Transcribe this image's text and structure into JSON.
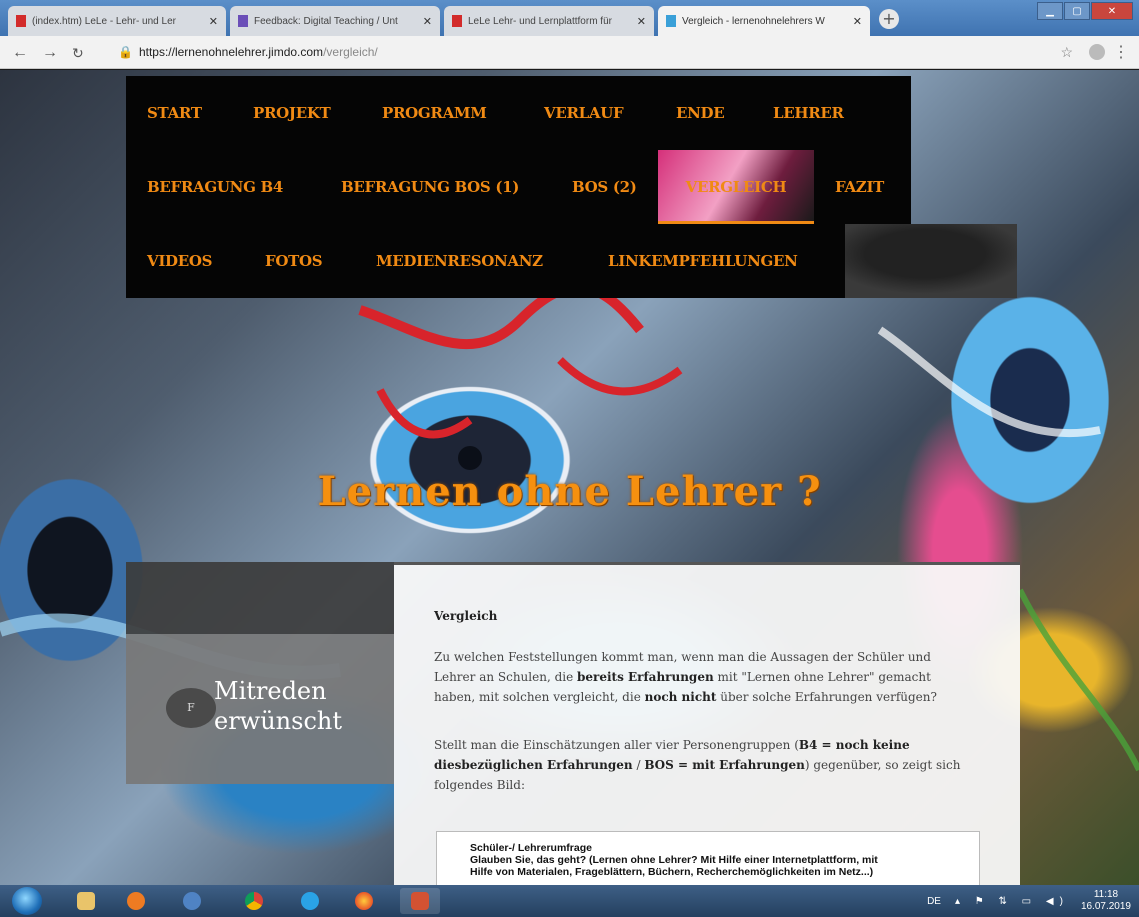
{
  "browser": {
    "tabs": [
      {
        "title": "(index.htm) LeLe - Lehr- und Ler",
        "favicon_color": "#d22b2b",
        "active": false
      },
      {
        "title": "Feedback: Digital Teaching / Unt",
        "favicon_color": "#6b4fb8",
        "active": false
      },
      {
        "title": "LeLe Lehr- und Lernplattform für",
        "favicon_color": "#d22b2b",
        "active": false
      },
      {
        "title": "Vergleich - lernenohnelehrers W",
        "favicon_color": "#3aa0d8",
        "active": true
      }
    ],
    "new_tab_icon": "+",
    "url_host": "https://lernenohnelehrer.jimdo.com",
    "url_path": "/vergleich/"
  },
  "site": {
    "nav": [
      {
        "label": "START"
      },
      {
        "label": "PROJEKT"
      },
      {
        "label": "PROGRAMM"
      },
      {
        "label": "VERLAUF"
      },
      {
        "label": "ENDE"
      },
      {
        "label": "LEHRER"
      },
      {
        "label": "BEFRAGUNG B4"
      },
      {
        "label": "BEFRAGUNG BOS (1)"
      },
      {
        "label": "BOS (2)"
      },
      {
        "label": "VERGLEICH",
        "active": true
      },
      {
        "label": "FAZIT"
      },
      {
        "label": "VIDEOS"
      },
      {
        "label": "FOTOS"
      },
      {
        "label": "MEDIENRESONANZ"
      },
      {
        "label": "LINKEMPFEHLUNGEN"
      }
    ],
    "hero_title": "Lernen ohne Lehrer ?",
    "sidebar": {
      "badge": "F",
      "label_line1": "Mitreden",
      "label_line2": "erwünscht"
    },
    "content": {
      "heading": "Vergleich",
      "p1": {
        "t1": "Zu welchen Feststellungen kommt man, wenn man die Aussagen der Schüler und Lehrer an Schulen, die ",
        "b1": "bereits Erfahrungen",
        "t2": " mit \"Lernen ohne Lehrer\" gemacht haben, mit solchen vergleicht, die ",
        "b2": "noch nicht",
        "t3": " über solche Erfahrungen verfügen?"
      },
      "p2": {
        "t1": "Stellt man die Einschätzungen aller vier Personengruppen (",
        "b1": "B4 = noch keine diesbezüglichen Erfahrungen",
        "t2": " / ",
        "b2": "BOS = mit Erfahrungen",
        "t3": ") gegenüber, so zeigt sich folgendes Bild:"
      },
      "survey": {
        "line1": "Schüler-/ Lehrerumfrage",
        "line2": "Glauben Sie, das geht? (Lernen ohne Lehrer? Mit Hilfe einer Internetplattform, mit",
        "line3": "Hilfe von Materialen, Frageblättern, Büchern, Recherchemöglichkeiten im Netz...)"
      }
    }
  },
  "taskbar": {
    "apps": [
      "explorer",
      "media-player",
      "chrome-remote",
      "chrome",
      "internet-explorer",
      "firefox",
      "presentation"
    ],
    "lang": "DE",
    "time": "11:18",
    "date": "16.07.2019"
  }
}
